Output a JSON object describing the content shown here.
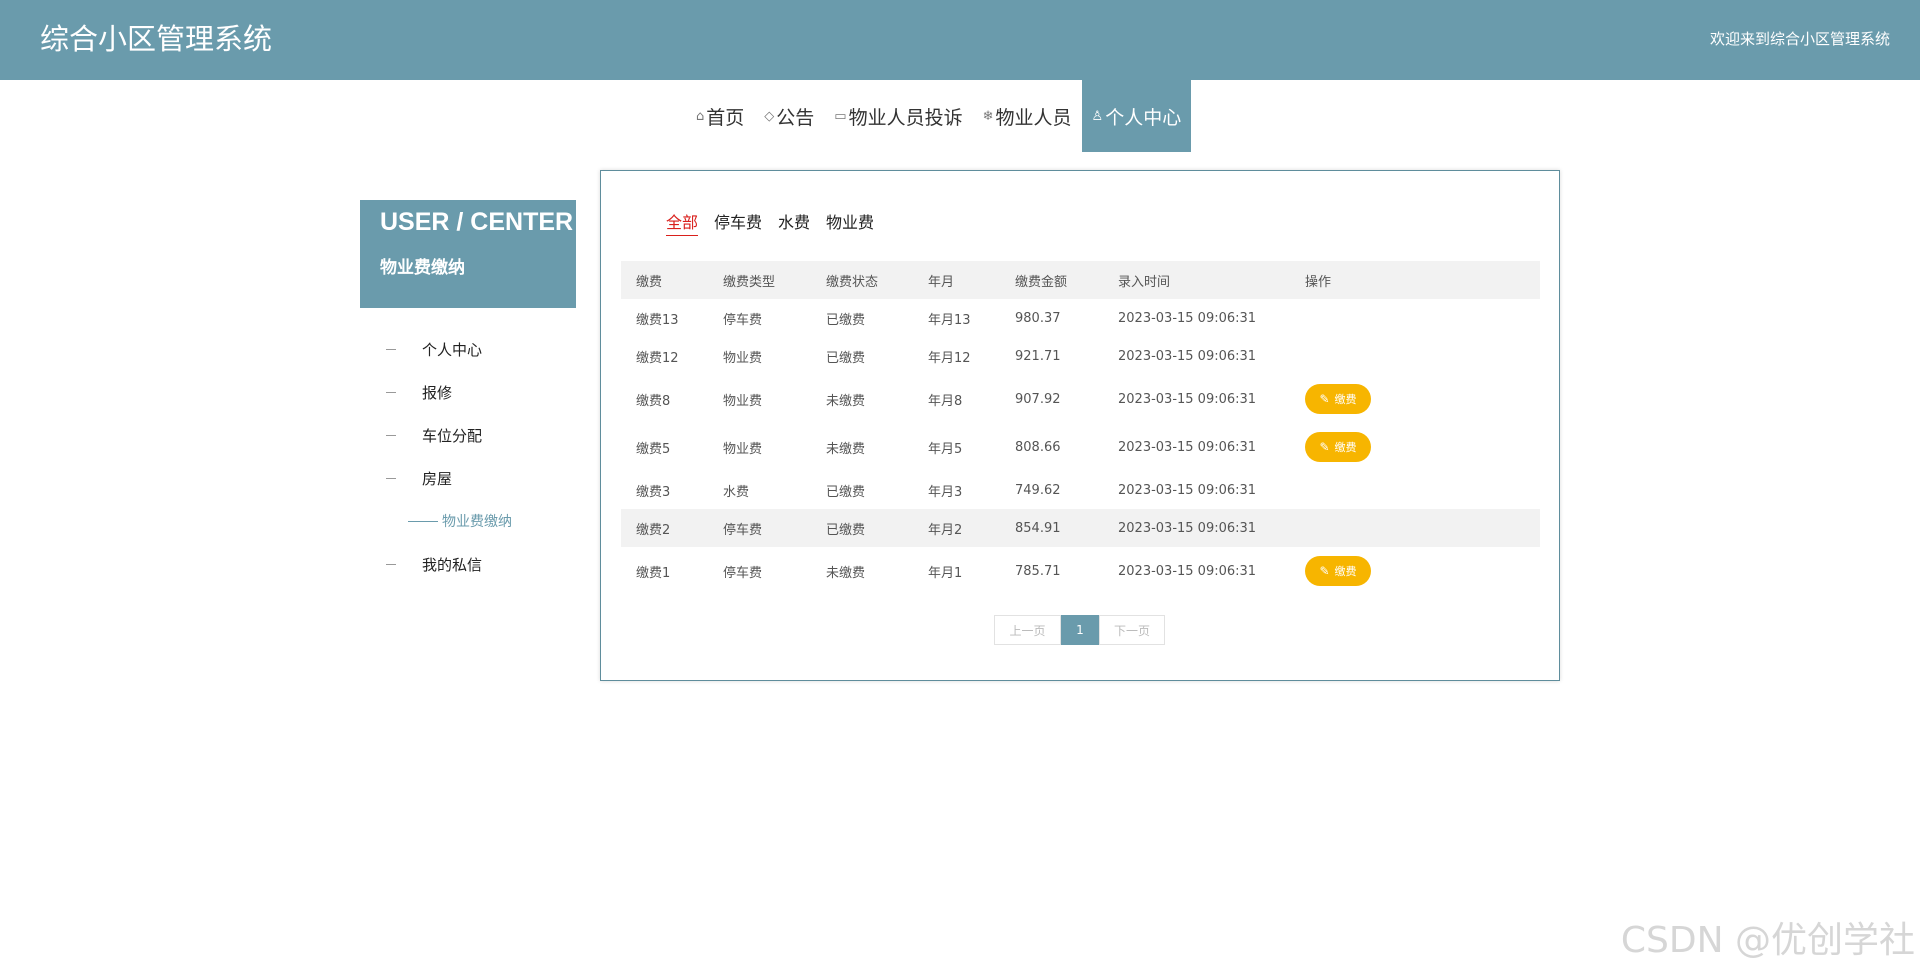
{
  "header": {
    "logo": "综合小区管理系统",
    "welcome": "欢迎来到综合小区管理系统"
  },
  "nav": {
    "items": [
      {
        "icon": "home-icon",
        "glyph": "⌂",
        "label": "首页"
      },
      {
        "icon": "tag-icon",
        "glyph": "◇",
        "label": "公告"
      },
      {
        "icon": "clipboard-icon",
        "glyph": "▭",
        "label": "物业人员投诉"
      },
      {
        "icon": "snowflake-icon",
        "glyph": "❄",
        "label": "物业人员"
      },
      {
        "icon": "user-icon",
        "glyph": "♙",
        "label": "个人中心"
      }
    ],
    "active_index": 4
  },
  "sidebar": {
    "title_en": "USER / CENTER",
    "title_cn": "物业费缴纳",
    "items": [
      {
        "label": "个人中心"
      },
      {
        "label": "报修"
      },
      {
        "label": "车位分配"
      },
      {
        "label": "房屋"
      },
      {
        "label": "物业费缴纳",
        "sub": true,
        "active": true
      },
      {
        "label": "我的私信"
      }
    ]
  },
  "tabs": {
    "items": [
      "全部",
      "停车费",
      "水费",
      "物业费"
    ],
    "active_index": 0
  },
  "table": {
    "columns": [
      "缴费",
      "缴费类型",
      "缴费状态",
      "年月",
      "缴费金额",
      "录入时间",
      "操作"
    ],
    "rows": [
      {
        "name": "缴费13",
        "type": "停车费",
        "status": "已缴费",
        "month": "年月13",
        "amount": "980.37",
        "time": "2023-03-15 09:06:31",
        "action": ""
      },
      {
        "name": "缴费12",
        "type": "物业费",
        "status": "已缴费",
        "month": "年月12",
        "amount": "921.71",
        "time": "2023-03-15 09:06:31",
        "action": ""
      },
      {
        "name": "缴费8",
        "type": "物业费",
        "status": "未缴费",
        "month": "年月8",
        "amount": "907.92",
        "time": "2023-03-15 09:06:31",
        "action": "缴费"
      },
      {
        "name": "缴费5",
        "type": "物业费",
        "status": "未缴费",
        "month": "年月5",
        "amount": "808.66",
        "time": "2023-03-15 09:06:31",
        "action": "缴费"
      },
      {
        "name": "缴费3",
        "type": "水费",
        "status": "已缴费",
        "month": "年月3",
        "amount": "749.62",
        "time": "2023-03-15 09:06:31",
        "action": ""
      },
      {
        "name": "缴费2",
        "type": "停车费",
        "status": "已缴费",
        "month": "年月2",
        "amount": "854.91",
        "time": "2023-03-15 09:06:31",
        "action": "",
        "highlight": true
      },
      {
        "name": "缴费1",
        "type": "停车费",
        "status": "未缴费",
        "month": "年月1",
        "amount": "785.71",
        "time": "2023-03-15 09:06:31",
        "action": "缴费"
      }
    ]
  },
  "pager": {
    "prev": "上一页",
    "current": "1",
    "next": "下一页"
  },
  "colors": {
    "primary": "#6a9bac",
    "pay_button": "#f7b500",
    "active_tab": "#d9201c"
  },
  "watermark": "CSDN @优创学社"
}
